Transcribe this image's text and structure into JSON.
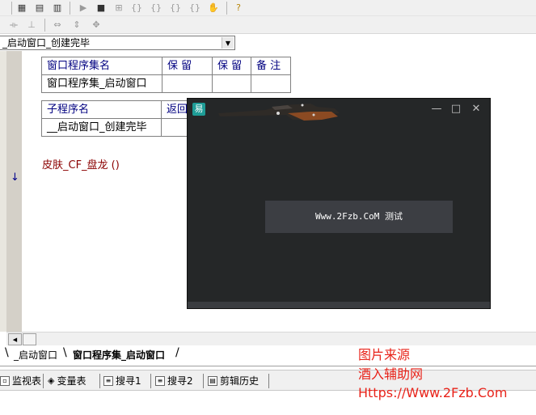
{
  "combo": {
    "value": "_启动窗口_创建完毕"
  },
  "assembly_table": {
    "headers": [
      "窗口程序集名",
      "保 留",
      "保 留",
      "备 注"
    ],
    "row": [
      "窗口程序集_启动窗口",
      "",
      "",
      ""
    ]
  },
  "sub_table": {
    "headers": [
      "子程序名",
      "返回"
    ],
    "row": [
      "__启动窗口_创建完毕",
      ""
    ]
  },
  "code": {
    "line": "皮肤_CF_盘龙 ()"
  },
  "doc_tabs": [
    "_启动窗口",
    "窗口程序集_启动窗口"
  ],
  "bottom_tabs": [
    "监视表",
    "变量表",
    "搜寻1",
    "搜寻2",
    "剪辑历史"
  ],
  "popup": {
    "logo_char": "易",
    "button_label": "Www.2Fzb.CoM 测试",
    "controls": [
      "—",
      "□",
      "✕"
    ]
  },
  "watermark": [
    "图片来源",
    "酒入辅助网",
    "Https://Www.2Fzb.Com"
  ],
  "colors": {
    "watermark": "#e8231a",
    "popup_bg": "#252728",
    "popup_button": "#3c3e43"
  }
}
